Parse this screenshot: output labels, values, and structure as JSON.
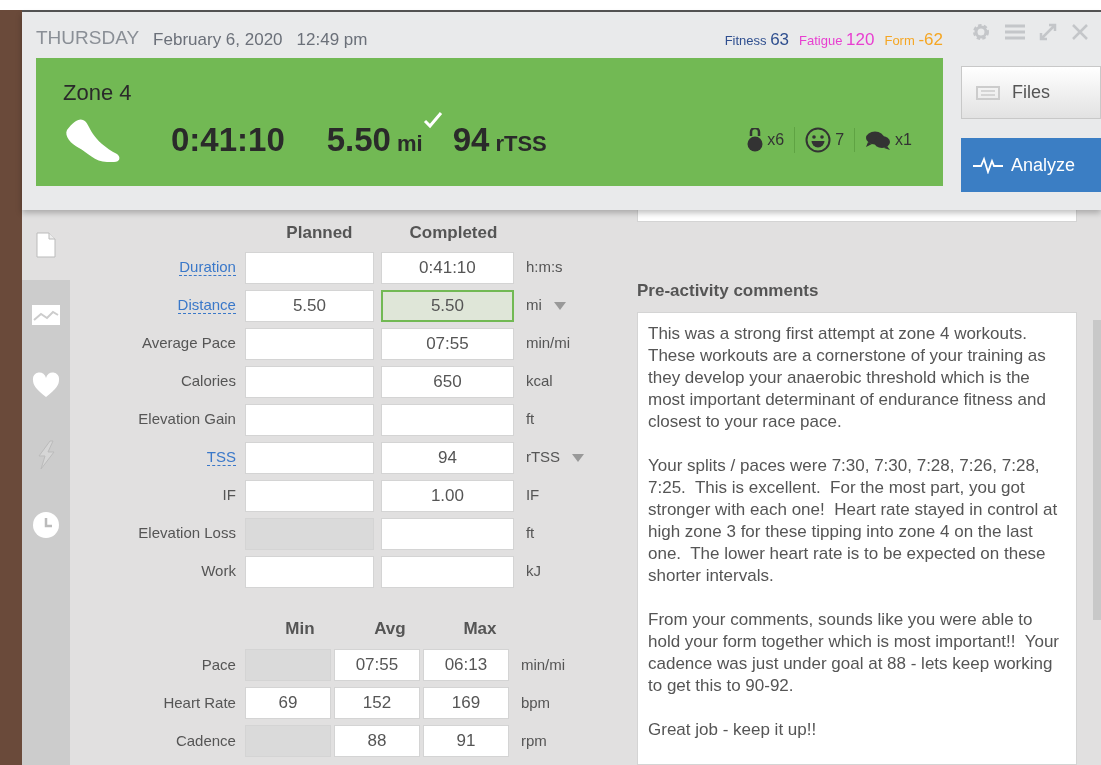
{
  "header": {
    "day": "THURSDAY",
    "date": "February 6, 2020",
    "time": "12:49 pm",
    "metrics": [
      {
        "label": "Fitness",
        "value": "63",
        "color": "#2f4f8f"
      },
      {
        "label": "Fatigue",
        "value": "120",
        "color": "#e83fd0"
      },
      {
        "label": "Form",
        "value": "-62",
        "color": "#f5a623"
      }
    ]
  },
  "workout": {
    "title": "Zone 4",
    "duration": "0:41:10",
    "distance": "5.50",
    "distance_unit": "mi",
    "completed": true,
    "tss": "94",
    "tss_unit": "rTSS",
    "counters": [
      {
        "kind": "kettlebell",
        "text": "x6"
      },
      {
        "kind": "smiley",
        "text": "7"
      },
      {
        "kind": "comments",
        "text": "x1"
      }
    ]
  },
  "buttons": [
    {
      "kind": "files",
      "label": "Files"
    },
    {
      "kind": "analyze",
      "label": "Analyze"
    }
  ],
  "sidebar": {
    "items": [
      {
        "kind": "document",
        "selected": true
      },
      {
        "kind": "chart",
        "selected": false
      },
      {
        "kind": "heart",
        "selected": false
      },
      {
        "kind": "bolt",
        "selected": false
      },
      {
        "kind": "clock",
        "selected": false
      }
    ]
  },
  "summary": {
    "columns": [
      "Planned",
      "Completed"
    ],
    "rows": [
      {
        "label": "Duration",
        "link": true,
        "planned": {
          "disabled": false
        },
        "completed": {
          "value": "0:41:10",
          "highlighted": false
        },
        "unit": "h:m:s",
        "dropdown": false
      },
      {
        "label": "Distance",
        "link": true,
        "planned": {
          "value": "5.50",
          "disabled": false
        },
        "completed": {
          "value": "5.50",
          "highlighted": true
        },
        "unit": "mi",
        "dropdown": true
      },
      {
        "label": "Average Pace",
        "link": false,
        "planned": {
          "disabled": false
        },
        "completed": {
          "value": "07:55",
          "highlighted": false
        },
        "unit": "min/mi",
        "dropdown": false
      },
      {
        "label": "Calories",
        "link": false,
        "planned": {
          "disabled": false
        },
        "completed": {
          "value": "650",
          "highlighted": false
        },
        "unit": "kcal",
        "dropdown": false
      },
      {
        "label": "Elevation Gain",
        "link": false,
        "planned": {
          "disabled": false
        },
        "completed": {
          "highlighted": false
        },
        "unit": "ft",
        "dropdown": false
      },
      {
        "label": "TSS",
        "link": true,
        "planned": {
          "disabled": false
        },
        "completed": {
          "value": "94",
          "highlighted": false
        },
        "unit": "rTSS",
        "dropdown": true
      },
      {
        "label": "IF",
        "link": false,
        "planned": {
          "disabled": false
        },
        "completed": {
          "value": "1.00",
          "highlighted": false
        },
        "unit": "IF",
        "dropdown": false
      },
      {
        "label": "Elevation Loss",
        "link": false,
        "planned": {
          "disabled": true
        },
        "completed": {
          "highlighted": false
        },
        "unit": "ft",
        "dropdown": false
      },
      {
        "label": "Work",
        "link": false,
        "planned": {
          "disabled": false
        },
        "completed": {
          "highlighted": false
        },
        "unit": "kJ",
        "dropdown": false
      }
    ]
  },
  "stats": {
    "columns": [
      "Min",
      "Avg",
      "Max"
    ],
    "rows": [
      {
        "label": "Pace",
        "cells": [
          {
            "disabled": true
          },
          {
            "value": "07:55",
            "disabled": false
          },
          {
            "value": "06:13",
            "disabled": false
          }
        ],
        "unit": "min/mi"
      },
      {
        "label": "Heart Rate",
        "cells": [
          {
            "value": "69",
            "disabled": false
          },
          {
            "value": "152",
            "disabled": false
          },
          {
            "value": "169",
            "disabled": false
          }
        ],
        "unit": "bpm"
      },
      {
        "label": "Cadence",
        "cells": [
          {
            "disabled": true
          },
          {
            "value": "88",
            "disabled": false
          },
          {
            "value": "91",
            "disabled": false
          }
        ],
        "unit": "rpm"
      }
    ]
  },
  "comments": {
    "title": "Pre-activity comments",
    "paragraphs": [
      "This was a strong first attempt at zone 4 workouts.  These workouts are a cornerstone of your training as they develop your anaerobic threshold which is the most important determinant of endurance fitness and closest to your race pace.",
      "Your splits / paces were 7:30, 7:30, 7:28, 7:26, 7:28, 7:25.  This is excellent.  For the most part, you got stronger with each one!  Heart rate stayed in control at high zone 3 for these tipping into zone 4 on the last one.  The lower heart rate is to be expected on these shorter intervals.",
      "From your comments, sounds like you were able to hold your form together which is most important!!  Your cadence was just under goal at 88 - lets keep working to get this to 90-92.",
      "Great job - keep it up!!"
    ]
  }
}
